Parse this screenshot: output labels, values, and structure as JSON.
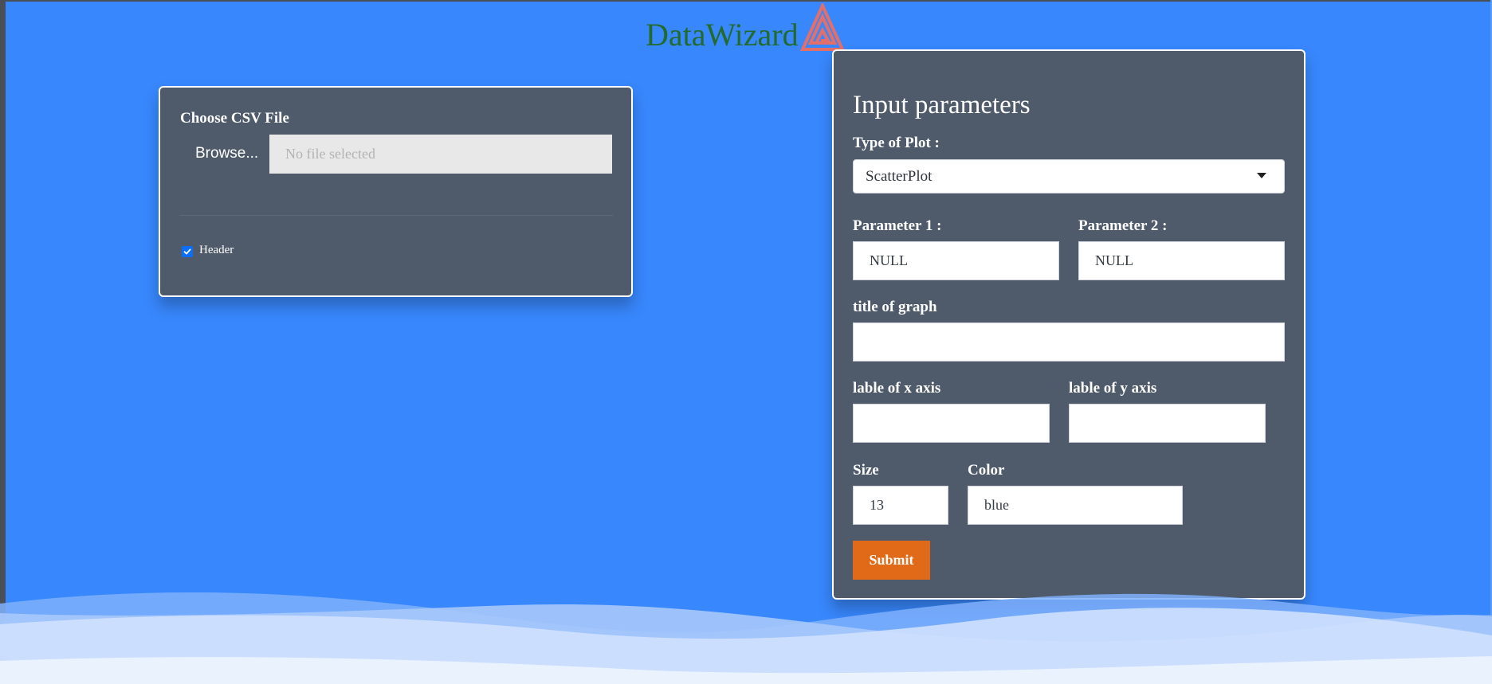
{
  "brand": {
    "name": "DataWizard",
    "text_color": "#236b2a",
    "logo_color": "#e26f6a",
    "logo_icon": "triangle-spiral-logo"
  },
  "file_panel": {
    "title": "Choose CSV File",
    "browse_label": "Browse...",
    "file_placeholder": "No file selected",
    "header_checkbox": {
      "label": "Header",
      "checked": true
    }
  },
  "params_panel": {
    "title": "Input parameters",
    "plot_type": {
      "label": "Type of Plot :",
      "selected": "ScatterPlot"
    },
    "param1": {
      "label": "Parameter 1 :",
      "value": "NULL"
    },
    "param2": {
      "label": "Parameter 2 :",
      "value": "NULL"
    },
    "graph_title": {
      "label": "title of graph",
      "value": ""
    },
    "x_axis": {
      "label": "lable of x axis",
      "value": ""
    },
    "y_axis": {
      "label": "lable of y axis",
      "value": ""
    },
    "size": {
      "label": "Size",
      "value": "13"
    },
    "color": {
      "label": "Color",
      "value": "blue"
    },
    "submit_label": "Submit"
  },
  "colors": {
    "background": "#3887fd",
    "panel": "#4f5b6a",
    "submit": "#e06a18",
    "checkbox": "#0b6ef5"
  }
}
